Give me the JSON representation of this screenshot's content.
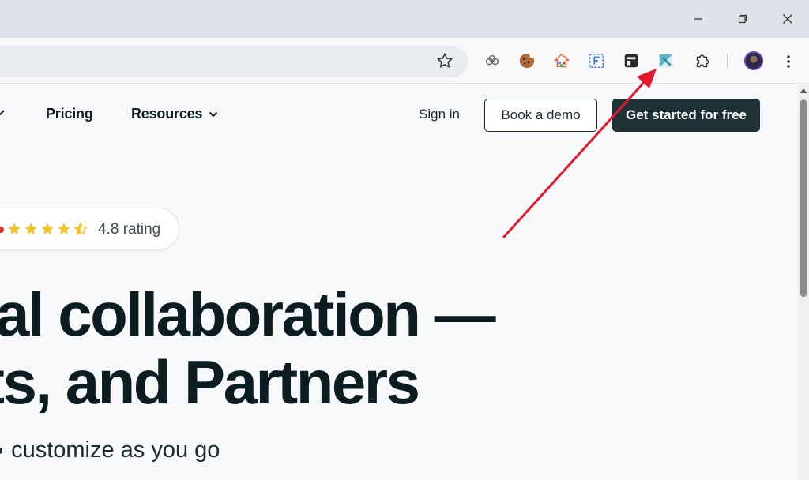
{
  "nav": {
    "pricing": "Pricing",
    "resources": "Resources",
    "sign_in": "Sign in",
    "book_demo": "Book a demo",
    "get_started": "Get started for free"
  },
  "rating": {
    "stars": 4.5,
    "text": "4.8 rating"
  },
  "hero": {
    "line1": "al collaboration —",
    "line2": "ts, and Partners",
    "subtitle": "customize as you go"
  },
  "colors": {
    "cta_bg": "#1d3137",
    "star": "#f2c12e",
    "annotation": "#e3182d"
  },
  "icons": {
    "toolbar": [
      "bookmark-star-icon",
      "cloud-extension-icon",
      "cookie-extension-icon",
      "home-extension-icon",
      "form-extension-icon",
      "window-extension-icon",
      "highlighted-extension-icon",
      "puzzle-extensions-icon",
      "profile-avatar",
      "menu-kebab-icon"
    ]
  }
}
